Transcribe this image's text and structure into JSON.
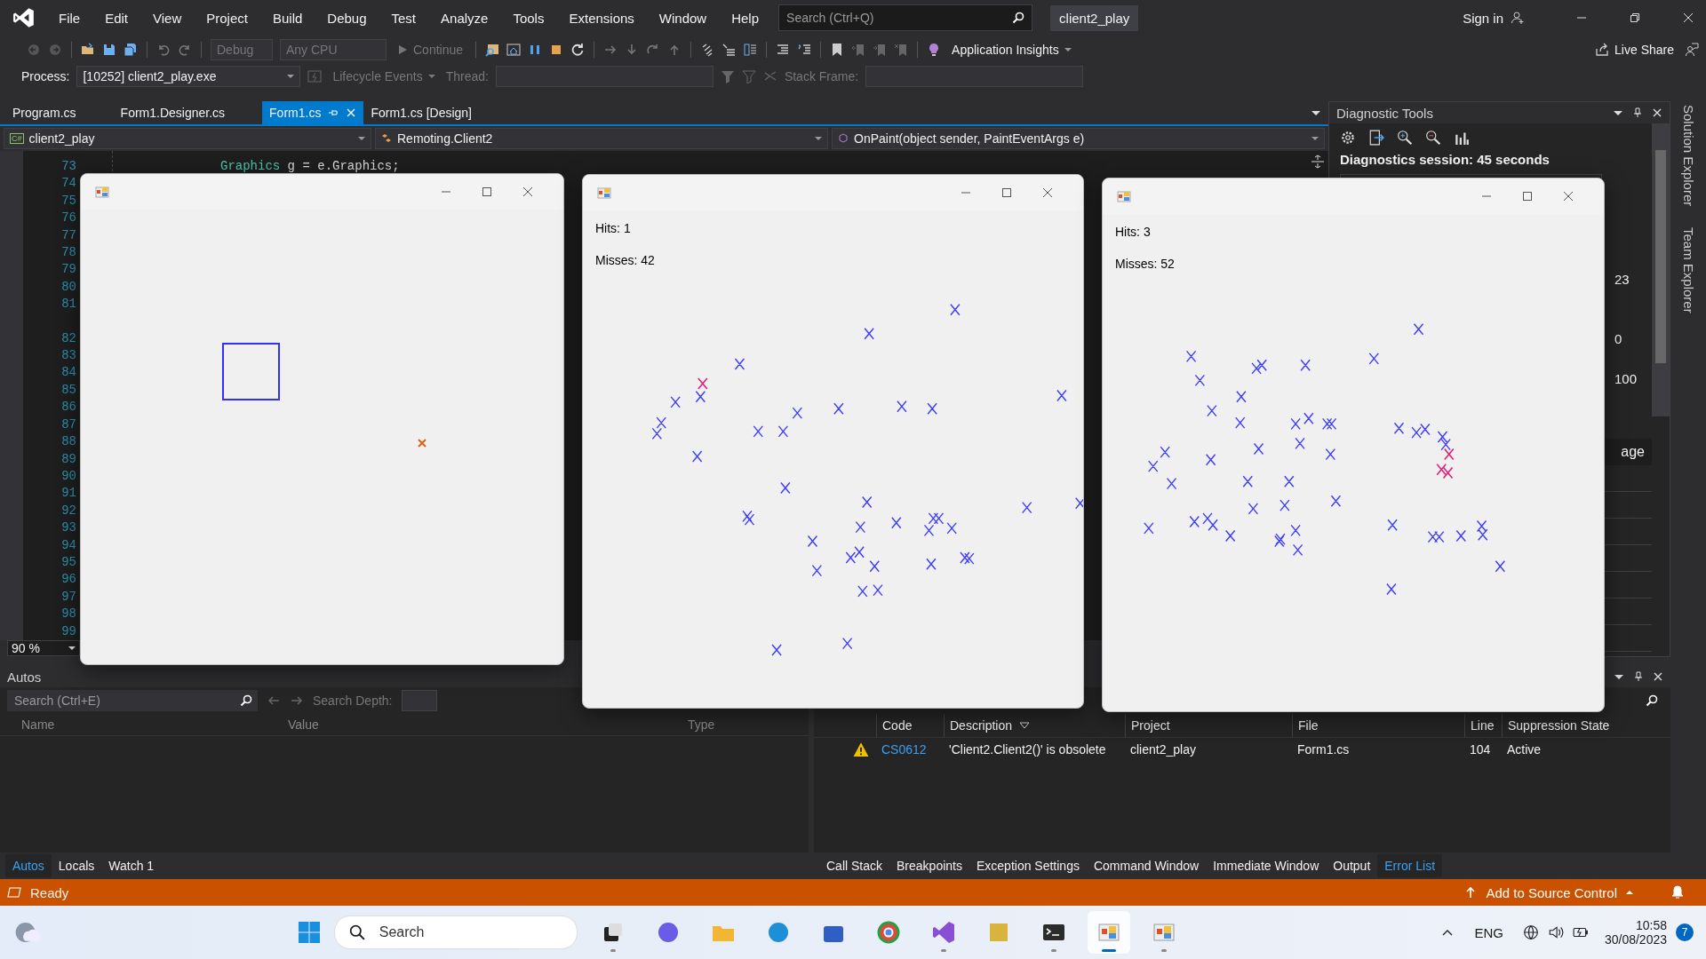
{
  "title_bar": {
    "menus": [
      "File",
      "Edit",
      "View",
      "Project",
      "Build",
      "Debug",
      "Test",
      "Analyze",
      "Tools",
      "Extensions",
      "Window",
      "Help"
    ],
    "search": {
      "placeholder": "Search (Ctrl+Q)"
    },
    "solution_name": "client2_play",
    "sign_in": "Sign in"
  },
  "toolbar": {
    "configuration": "Debug",
    "platform": "Any CPU",
    "continue": "Continue",
    "app_insights": "Application Insights",
    "live_share": "Live Share"
  },
  "debug_location": {
    "process_label": "Process:",
    "process": "[10252] client2_play.exe",
    "lifecycle": "Lifecycle Events",
    "thread_label": "Thread:",
    "stack_frame_label": "Stack Frame:"
  },
  "editor": {
    "tabs": [
      {
        "label": "Program.cs",
        "selected": false,
        "pinned": false
      },
      {
        "label": "Form1.Designer.cs",
        "selected": false,
        "pinned": false
      },
      {
        "label": "Form1.cs",
        "selected": true,
        "pinned": true
      },
      {
        "label": "Form1.cs [Design]",
        "selected": false,
        "pinned": false
      }
    ],
    "navigation": {
      "project_badge": "C#",
      "project": "client2_play",
      "type": "Remoting.Client2",
      "member": "OnPaint(object sender, PaintEventArgs e)"
    },
    "line_numbers": [
      "73",
      "74",
      "75",
      "76",
      "77",
      "78",
      "79",
      "80",
      "81",
      "82",
      "83",
      "84",
      "85",
      "86",
      "87",
      "88",
      "89",
      "90",
      "91",
      "92",
      "93",
      "94",
      "95",
      "96",
      "97",
      "98",
      "99"
    ],
    "code_line": {
      "type_name": "Graphics",
      "rest": "g = e.Graphics;"
    },
    "zoom": "90 %"
  },
  "diagnostic_tools": {
    "title": "Diagnostic Tools",
    "session": "Diagnostics session: 45 seconds",
    "axis_values": [
      "23",
      "0",
      "100"
    ],
    "partial_label": "age"
  },
  "side_tabs": [
    "Solution Explorer",
    "Team Explorer"
  ],
  "autos": {
    "title": "Autos",
    "search": {
      "placeholder": "Search (Ctrl+E)"
    },
    "search_depth_label": "Search Depth:",
    "columns": [
      "Name",
      "Value",
      "Type"
    ]
  },
  "error_list": {
    "columns": [
      "Code",
      "Description",
      "Project",
      "File",
      "Line",
      "Suppression State"
    ],
    "rows": [
      {
        "kind": "warning",
        "code": "CS0612",
        "description": "'Client2.Client2()' is obsolete",
        "project": "client2_play",
        "file": "Form1.cs",
        "line": "104",
        "state": "Active"
      }
    ]
  },
  "bottom_tabs_left": [
    {
      "label": "Autos",
      "selected": true
    },
    {
      "label": "Locals",
      "selected": false
    },
    {
      "label": "Watch 1",
      "selected": false
    }
  ],
  "bottom_tabs_right": [
    {
      "label": "Call Stack",
      "selected": false
    },
    {
      "label": "Breakpoints",
      "selected": false
    },
    {
      "label": "Exception Settings",
      "selected": false
    },
    {
      "label": "Command Window",
      "selected": false
    },
    {
      "label": "Immediate Window",
      "selected": false
    },
    {
      "label": "Output",
      "selected": false
    },
    {
      "label": "Error List",
      "selected": true
    }
  ],
  "status_bar": {
    "status": "Ready",
    "source_control": "Add to Source Control"
  },
  "taskbar": {
    "search": {
      "placeholder": "Search"
    },
    "apps": [
      {
        "kind": "taskview",
        "open": true,
        "selected": false
      },
      {
        "kind": "chat",
        "open": false,
        "selected": false
      },
      {
        "kind": "folder",
        "open": false,
        "selected": false
      },
      {
        "kind": "browser",
        "open": false,
        "selected": false
      },
      {
        "kind": "store",
        "open": false,
        "selected": false
      },
      {
        "kind": "chrome",
        "open": false,
        "selected": false
      },
      {
        "kind": "vs",
        "open": true,
        "selected": false
      },
      {
        "kind": "tools",
        "open": false,
        "selected": false
      },
      {
        "kind": "terminal",
        "open": true,
        "selected": false
      },
      {
        "kind": "form",
        "open": true,
        "selected": true
      },
      {
        "kind": "form",
        "open": true,
        "selected": false
      }
    ],
    "language": "ENG",
    "time": "10:58",
    "date": "30/08/2023",
    "notification_count": "7"
  },
  "app_windows": [
    {
      "kind": "target"
    },
    {
      "kind": "score",
      "hits": "Hits: 1",
      "misses": "Misses: 42"
    },
    {
      "kind": "score",
      "hits": "Hits: 3",
      "misses": "Misses: 52"
    }
  ]
}
